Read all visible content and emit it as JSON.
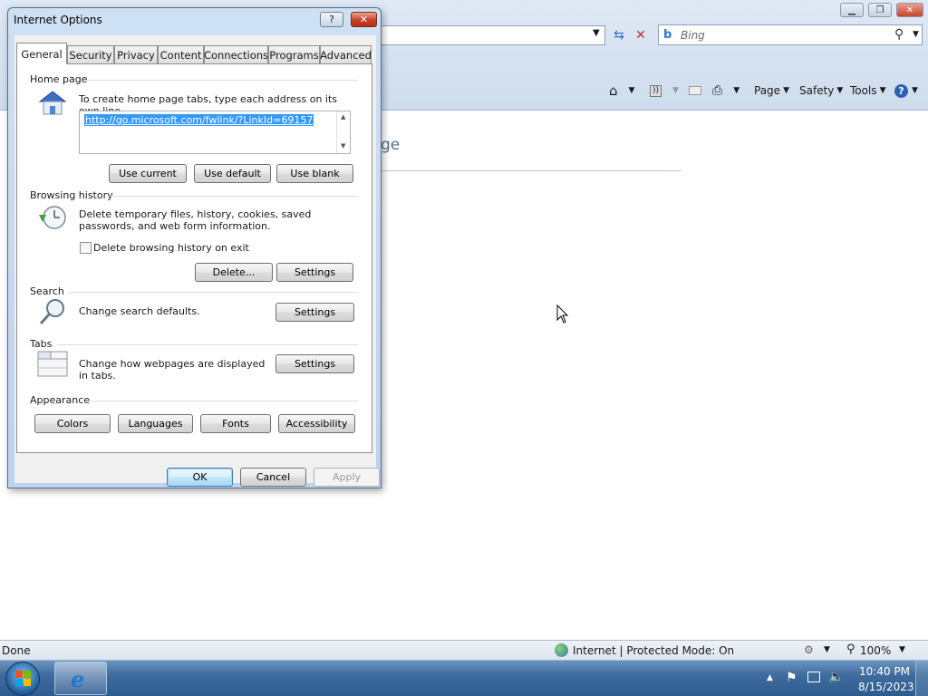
{
  "browser": {
    "search_placeholder": "Bing",
    "page_heading_fragment": "ge",
    "commands": {
      "page": "Page",
      "safety": "Safety",
      "tools": "Tools"
    }
  },
  "status": {
    "left": "Done",
    "zone": "Internet | Protected Mode: On",
    "zoom": "100%"
  },
  "taskbar": {
    "time": "10:40 PM",
    "date": "8/15/2023"
  },
  "dialog": {
    "title": "Internet Options",
    "help": "?",
    "tabs": [
      "General",
      "Security",
      "Privacy",
      "Content",
      "Connections",
      "Programs",
      "Advanced"
    ],
    "active_tab": "General",
    "home_page": {
      "heading": "Home page",
      "description": "To create home page tabs, type each address on its own line.",
      "url": "http://go.microsoft.com/fwlink/?LinkId=69157",
      "buttons": [
        "Use current",
        "Use default",
        "Use blank"
      ]
    },
    "browsing_history": {
      "heading": "Browsing history",
      "description": "Delete temporary files, history, cookies, saved passwords, and web form information.",
      "checkbox_label": "Delete browsing history on exit",
      "checkbox_checked": false,
      "delete_button": "Delete...",
      "settings_button": "Settings"
    },
    "search": {
      "heading": "Search",
      "description": "Change search defaults.",
      "settings_button": "Settings"
    },
    "tabs_section": {
      "heading": "Tabs",
      "description": "Change how webpages are displayed in tabs.",
      "settings_button": "Settings"
    },
    "appearance": {
      "heading": "Appearance",
      "buttons": [
        "Colors",
        "Languages",
        "Fonts",
        "Accessibility"
      ]
    },
    "footer": {
      "ok": "OK",
      "cancel": "Cancel",
      "apply": "Apply"
    }
  }
}
